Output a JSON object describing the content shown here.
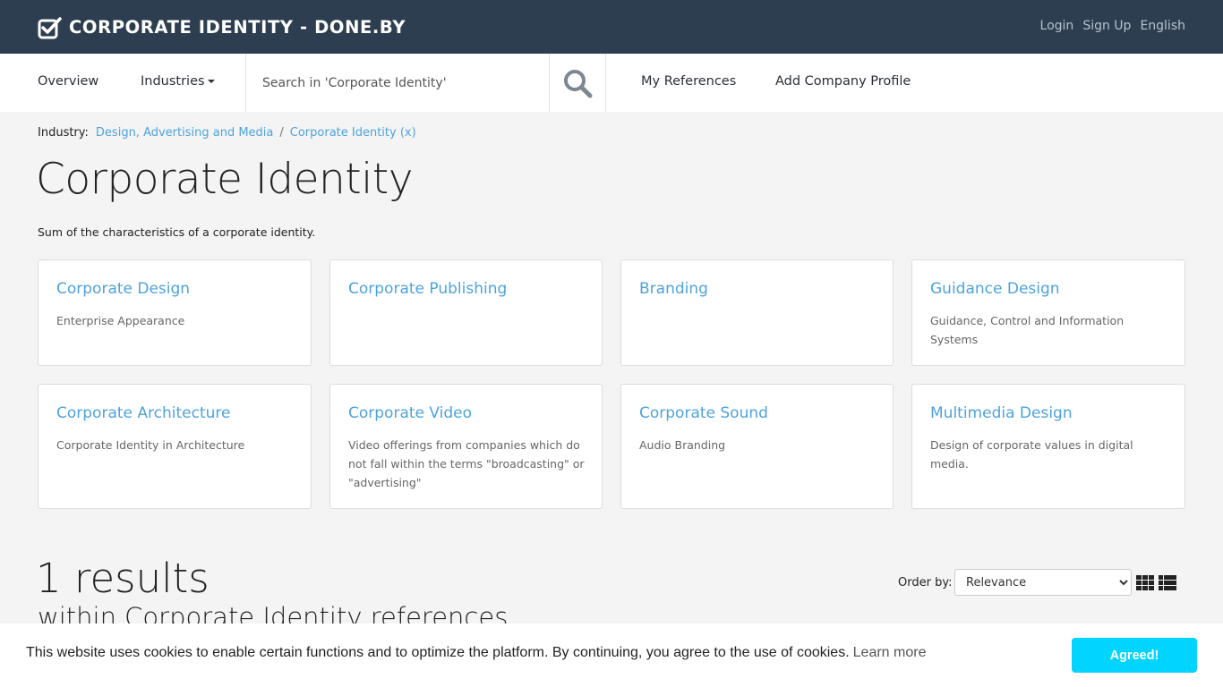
{
  "header": {
    "brand": "CORPORATE IDENTITY - DONE.BY",
    "links": [
      "Login",
      "Sign Up",
      "English"
    ]
  },
  "nav": {
    "overview": "Overview",
    "industries": "Industries",
    "search_placeholder": "Search in 'Corporate Identity'",
    "my_references": "My References",
    "add_company_profile": "Add Company Profile"
  },
  "breadcrumb": {
    "label": "Industry:",
    "items": [
      "Design, Advertising and Media",
      "Corporate Identity (x)"
    ],
    "separator": "/"
  },
  "page": {
    "title": "Corporate Identity",
    "description": "Sum of the characteristics of a corporate identity."
  },
  "cards": [
    {
      "title": "Corporate Design",
      "desc": "Enterprise Appearance"
    },
    {
      "title": "Corporate Publishing",
      "desc": ""
    },
    {
      "title": "Branding",
      "desc": ""
    },
    {
      "title": "Guidance Design",
      "desc": "Guidance, Control and Information Systems"
    },
    {
      "title": "Corporate Architecture",
      "desc": "Corporate Identity in Architecture"
    },
    {
      "title": "Corporate Video",
      "desc": "Video offerings from companies which do not fall within the terms \"broadcasting\" or \"advertising\""
    },
    {
      "title": "Corporate Sound",
      "desc": "Audio Branding"
    },
    {
      "title": "Multimedia Design",
      "desc": "Design of corporate values in digital media."
    }
  ],
  "results": {
    "count": "1 results",
    "subtitle": "within Corporate Identity references",
    "order_label": "Order by:",
    "order_selected": "Relevance"
  },
  "cookie": {
    "text": "This website uses cookies to enable certain functions and to optimize the platform. By continuing, you agree to the use of cookies.",
    "learn_more": "Learn more",
    "button": "Agreed!"
  },
  "colors": {
    "topbar": "#2c3e50",
    "link": "#4ea3dd",
    "cookie_button": "#00d4ff"
  }
}
